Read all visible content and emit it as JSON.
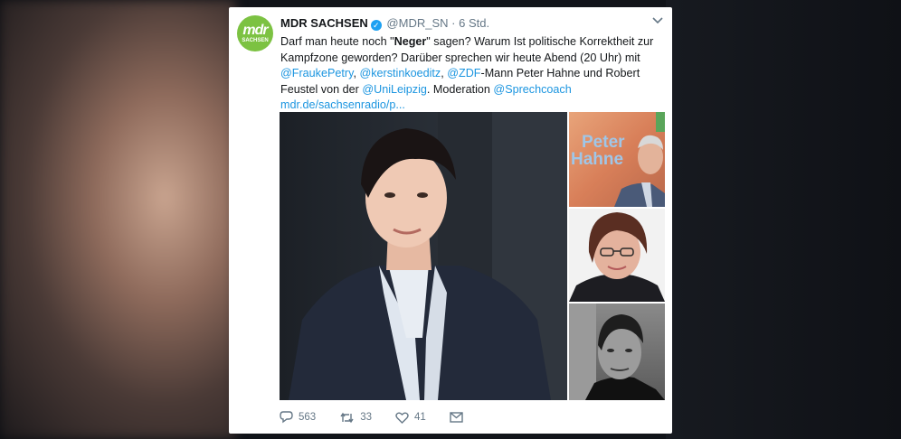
{
  "tweet": {
    "display_name": "MDR SACHSEN",
    "handle": "@MDR_SN",
    "separator": "·",
    "time": "6 Std.",
    "avatar": {
      "logo_top": "mdr",
      "logo_bottom": "SACHSEN"
    },
    "text": {
      "p1": "Darf man heute noch \"",
      "p1_bold": "Neger",
      "p1_rest": "\" sagen? Warum Ist politische Korrektheit zur Kampfzone geworden? Darüber sprechen wir heute Abend (20 Uhr) mit",
      "mention_petry": "@FraukePetry",
      "comma1": ", ",
      "mention_koeditz": "@kerstinkoeditz",
      "comma2": ", ",
      "mention_zdf": "@ZDF",
      "mid": "-Mann Peter Hahne und Robert Feustel von der ",
      "mention_uni": "@UniLeipzig",
      "moderation": ". Moderation ",
      "mention_coach": "@Sprechcoach",
      "url": "mdr.de/sachsenradio/p..."
    },
    "image_overlay_text": {
      "line1": "Peter",
      "line2": "Hahne"
    },
    "actions": {
      "replies": "563",
      "retweets": "33",
      "likes": "41"
    }
  },
  "colors": {
    "link": "#1b95e0",
    "verified": "#1da1f2",
    "avatar_bg": "#7cc242",
    "muted": "#657786"
  },
  "icons": [
    "chevron-down-icon",
    "verified-icon",
    "reply-icon",
    "retweet-icon",
    "like-icon",
    "message-icon"
  ]
}
